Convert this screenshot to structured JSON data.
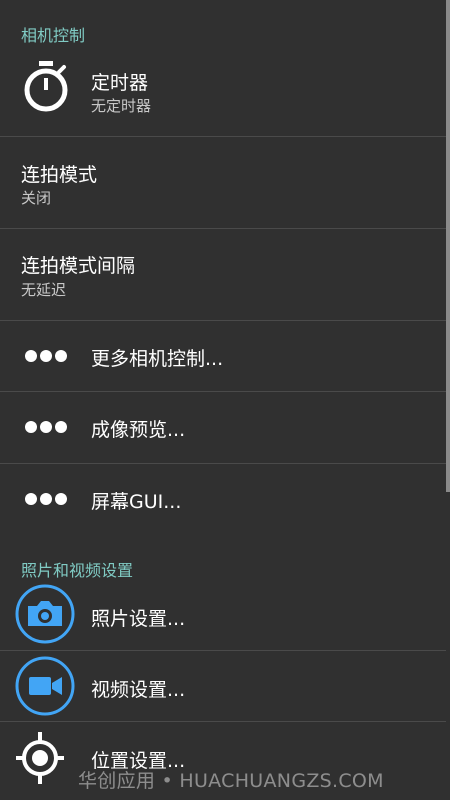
{
  "colors": {
    "background": "#303030",
    "section_header": "#80cbc4",
    "accent_blue": "#42a5f5",
    "divider": "#4a4a4a"
  },
  "camera_controls": {
    "header": "相机控制",
    "timer": {
      "icon": "stopwatch-icon",
      "title": "定时器",
      "summary": "无定时器"
    },
    "burst_mode": {
      "title": "连拍模式",
      "summary": "关闭"
    },
    "burst_interval": {
      "title": "连拍模式间隔",
      "summary": "无延迟"
    },
    "more_controls": {
      "icon": "more-dots-icon",
      "title": "更多相机控制..."
    },
    "preview": {
      "icon": "more-dots-icon",
      "title": "成像预览..."
    },
    "screen_gui": {
      "icon": "more-dots-icon",
      "title": "屏幕GUI..."
    }
  },
  "photo_video": {
    "header": "照片和视频设置",
    "photo_settings": {
      "icon": "camera-icon",
      "title": "照片设置..."
    },
    "video_settings": {
      "icon": "video-camera-icon",
      "title": "视频设置..."
    },
    "location_settings": {
      "icon": "location-crosshair-icon",
      "title": "位置设置..."
    }
  },
  "watermark": "华创应用 • HUACHUANGZS.COM"
}
